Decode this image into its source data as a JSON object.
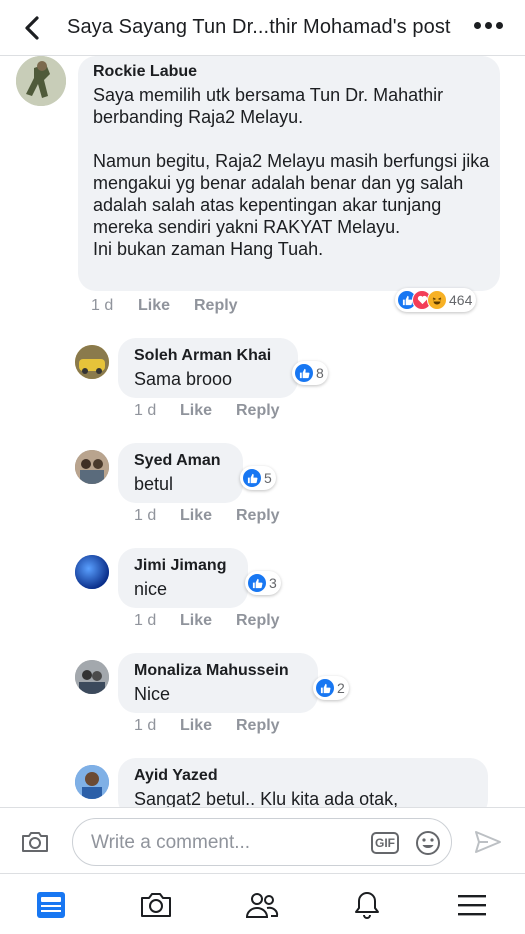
{
  "header": {
    "title": "Saya Sayang Tun Dr...thir Mohamad's post"
  },
  "comments": [
    {
      "author": "Rockie Labue",
      "text": "Saya memilih utk bersama Tun Dr. Mahathir berbanding Raja2 Melayu.\n\nNamun begitu, Raja2 Melayu masih berfungsi jika mengakui yg benar adalah benar dan yg salah adalah salah atas kepentingan akar tunjang mereka sendiri yakni RAKYAT Melayu.\nIni bukan zaman Hang Tuah.",
      "time": "1 d",
      "like": "Like",
      "reply": "Reply",
      "reactions": "464"
    },
    {
      "author": "Soleh Arman Khai",
      "text": "Sama brooo",
      "time": "1 d",
      "like": "Like",
      "reply": "Reply",
      "reactions": "8"
    },
    {
      "author": "Syed Aman",
      "text": "betul",
      "time": "1 d",
      "like": "Like",
      "reply": "Reply",
      "reactions": "5"
    },
    {
      "author": "Jimi Jimang",
      "text": "nice",
      "time": "1 d",
      "like": "Like",
      "reply": "Reply",
      "reactions": "3"
    },
    {
      "author": "Monaliza Mahussein",
      "text": "Nice",
      "time": "1 d",
      "like": "Like",
      "reply": "Reply",
      "reactions": "2"
    },
    {
      "author": "Ayid Yazed",
      "text": "Sangat2 betul.. Klu kita ada otak,"
    }
  ],
  "composer": {
    "placeholder": "Write a comment...",
    "gif": "GIF"
  },
  "colors": {
    "like": "#1877f2",
    "love": "#f33e58",
    "haha": "#f7b125",
    "bubble": "#f0f2f5",
    "meta": "#90949c"
  }
}
